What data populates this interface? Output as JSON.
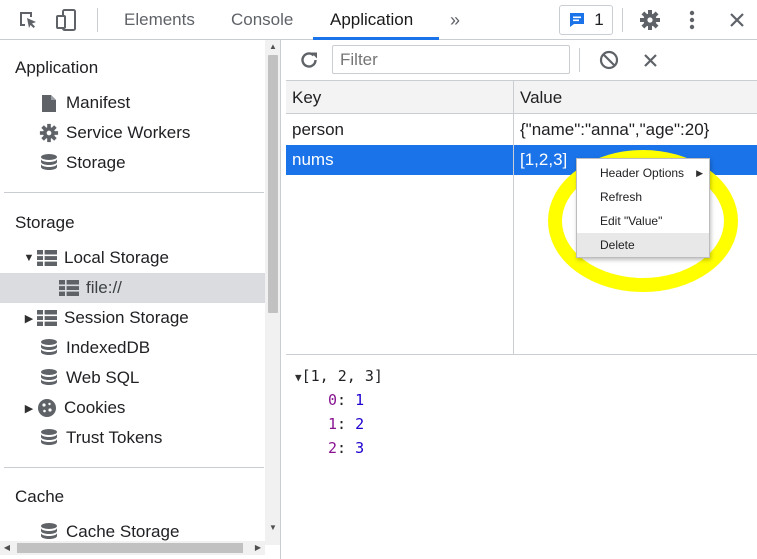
{
  "toolbar": {
    "tabs": [
      "Elements",
      "Console",
      "Application"
    ],
    "more_tabs_glyph": "»",
    "active_tab": "Application",
    "message_count": "1",
    "accent_color": "#1a73e8",
    "icons": [
      "inspect-element-icon",
      "device-toolbar-icon",
      "more-tabs-icon",
      "message-icon",
      "gear-icon",
      "kebab-menu-icon",
      "close-icon"
    ]
  },
  "sidebar": {
    "application_header": "Application",
    "application_items": [
      "Manifest",
      "Service Workers",
      "Storage"
    ],
    "storage_header": "Storage",
    "local_storage": "Local Storage",
    "local_storage_child": "file://",
    "session_storage": "Session Storage",
    "indexeddb": "IndexedDB",
    "websql": "Web SQL",
    "cookies": "Cookies",
    "trust_tokens": "Trust Tokens",
    "cache_header": "Cache",
    "cache_storage": "Cache Storage"
  },
  "main": {
    "filter_placeholder": "Filter",
    "columns": {
      "key": "Key",
      "value": "Value"
    },
    "rows": [
      {
        "key": "person",
        "value": "{\"name\":\"anna\",\"age\":20}"
      },
      {
        "key": "nums",
        "value": "[1,2,3]"
      }
    ],
    "selected_row": "nums",
    "selected_color": "#1a73e8",
    "preview": {
      "summary": "[1, 2, 3]",
      "entries": [
        {
          "index": "0",
          "value": "1"
        },
        {
          "index": "1",
          "value": "2"
        },
        {
          "index": "2",
          "value": "3"
        }
      ]
    }
  },
  "context_menu": {
    "items": [
      "Header Options",
      "Refresh",
      "Edit \"Value\"",
      "Delete"
    ],
    "hovered": "Delete",
    "highlight_color": "#ffff00"
  }
}
